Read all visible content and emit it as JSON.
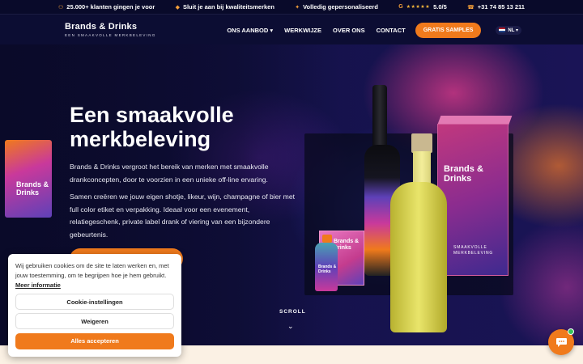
{
  "topbar": {
    "item1": "25.000+ klanten gingen je voor",
    "item2": "Sluit je aan bij kwaliteitsmerken",
    "item3": "Volledig gepersonaliseerd",
    "rating_icon": "G",
    "rating_stars": "★★★★★",
    "rating": "5.0/5",
    "phone": "+31 74 85 13 211"
  },
  "logo": {
    "main": "Brands & Drinks",
    "sub": "EEN SMAAKVOLLE MERKBELEVING"
  },
  "nav": {
    "items": [
      "ONS AANBOD ▾",
      "WERKWIJZE",
      "OVER ONS",
      "CONTACT"
    ],
    "cta": "GRATIS SAMPLES",
    "lang": "NL ▾"
  },
  "hero": {
    "title": "Een smaakvolle merkbeleving",
    "paragraph1": "Brands & Drinks vergroot het bereik van merken met smaakvolle drankconcepten, door te voorzien in een unieke off-line ervaring.",
    "paragraph2": "Samen creëren we jouw eigen shotje, likeur, wijn, champagne of bier met full color etiket en verpakking. Ideaal voor een evenement, relatiegeschenk, private label drank of viering van een bijzondere gebeurtenis."
  },
  "product": {
    "box_big_label": "Brands & Drinks",
    "box_big_sub": "SMAAKVOLLE MERKBELEVING",
    "bottle_label": "Brands & Drinks",
    "box_small_label": "Brands & Drinks",
    "mini_label": "Brands & Drinks"
  },
  "scroll": {
    "label": "SCROLL",
    "chevron": "⌄"
  },
  "cookie": {
    "text": "Wij gebruiken cookies om de site te laten werken en, met jouw toestemming, om te begrijpen hoe je hem gebruikt.",
    "link": "Meer informatie",
    "settings_button": "Cookie-instellingen",
    "decline_button": "Weigeren",
    "accept_button": "Alles accepteren"
  },
  "chat": {
    "icon": "chat-bubble-icon"
  },
  "colors": {
    "accent": "#f07a1c",
    "navy": "#0b0b2e",
    "online": "#36c45a"
  }
}
